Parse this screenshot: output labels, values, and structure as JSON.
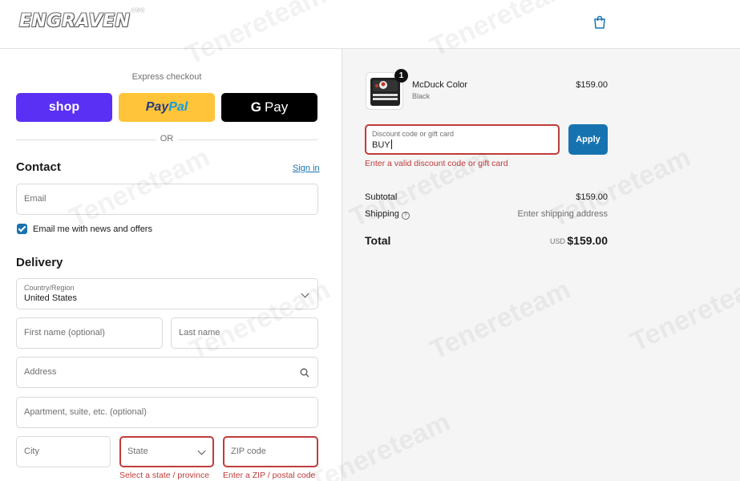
{
  "header": {
    "logo": "ENGRAVEN",
    "logo_suffix": "CNC",
    "bag_icon": "shopping-bag-icon"
  },
  "express_checkout": {
    "label": "Express checkout",
    "shop_label": "shop",
    "paypal_part1": "Pay",
    "paypal_part2": "Pal",
    "gpay_g": "G",
    "gpay_label": "Pay",
    "or_label": "OR"
  },
  "contact": {
    "title": "Contact",
    "signin": "Sign in",
    "email_placeholder": "Email",
    "newsletter_label": "Email me with news and offers",
    "newsletter_checked": true
  },
  "delivery": {
    "title": "Delivery",
    "country_label": "Country/Region",
    "country_value": "United States",
    "first_name_placeholder": "First name (optional)",
    "last_name_placeholder": "Last name",
    "address_placeholder": "Address",
    "apartment_placeholder": "Apartment, suite, etc. (optional)",
    "city_placeholder": "City",
    "state_placeholder": "State",
    "zip_placeholder": "ZIP code",
    "state_error": "Select a state / province",
    "zip_error": "Enter a ZIP / postal code"
  },
  "order": {
    "item_quantity": "1",
    "item_name": "McDuck Color",
    "item_variant": "Black",
    "item_price": "$159.00",
    "discount_label": "Discount code or gift card",
    "discount_value": "BUY",
    "apply_label": "Apply",
    "discount_error": "Enter a valid discount code or gift card",
    "subtotal_label": "Subtotal",
    "subtotal_value": "$159.00",
    "shipping_label": "Shipping",
    "shipping_value": "Enter shipping address",
    "total_label": "Total",
    "total_currency": "USD",
    "total_value": "$159.00"
  },
  "watermark_text": "Tenereteam",
  "colors": {
    "shop": "#5a31f4",
    "paypal": "#ffc439",
    "gpay": "#000000",
    "link": "#1773b0",
    "error": "#c03b3b",
    "apply": "#1773b0"
  }
}
